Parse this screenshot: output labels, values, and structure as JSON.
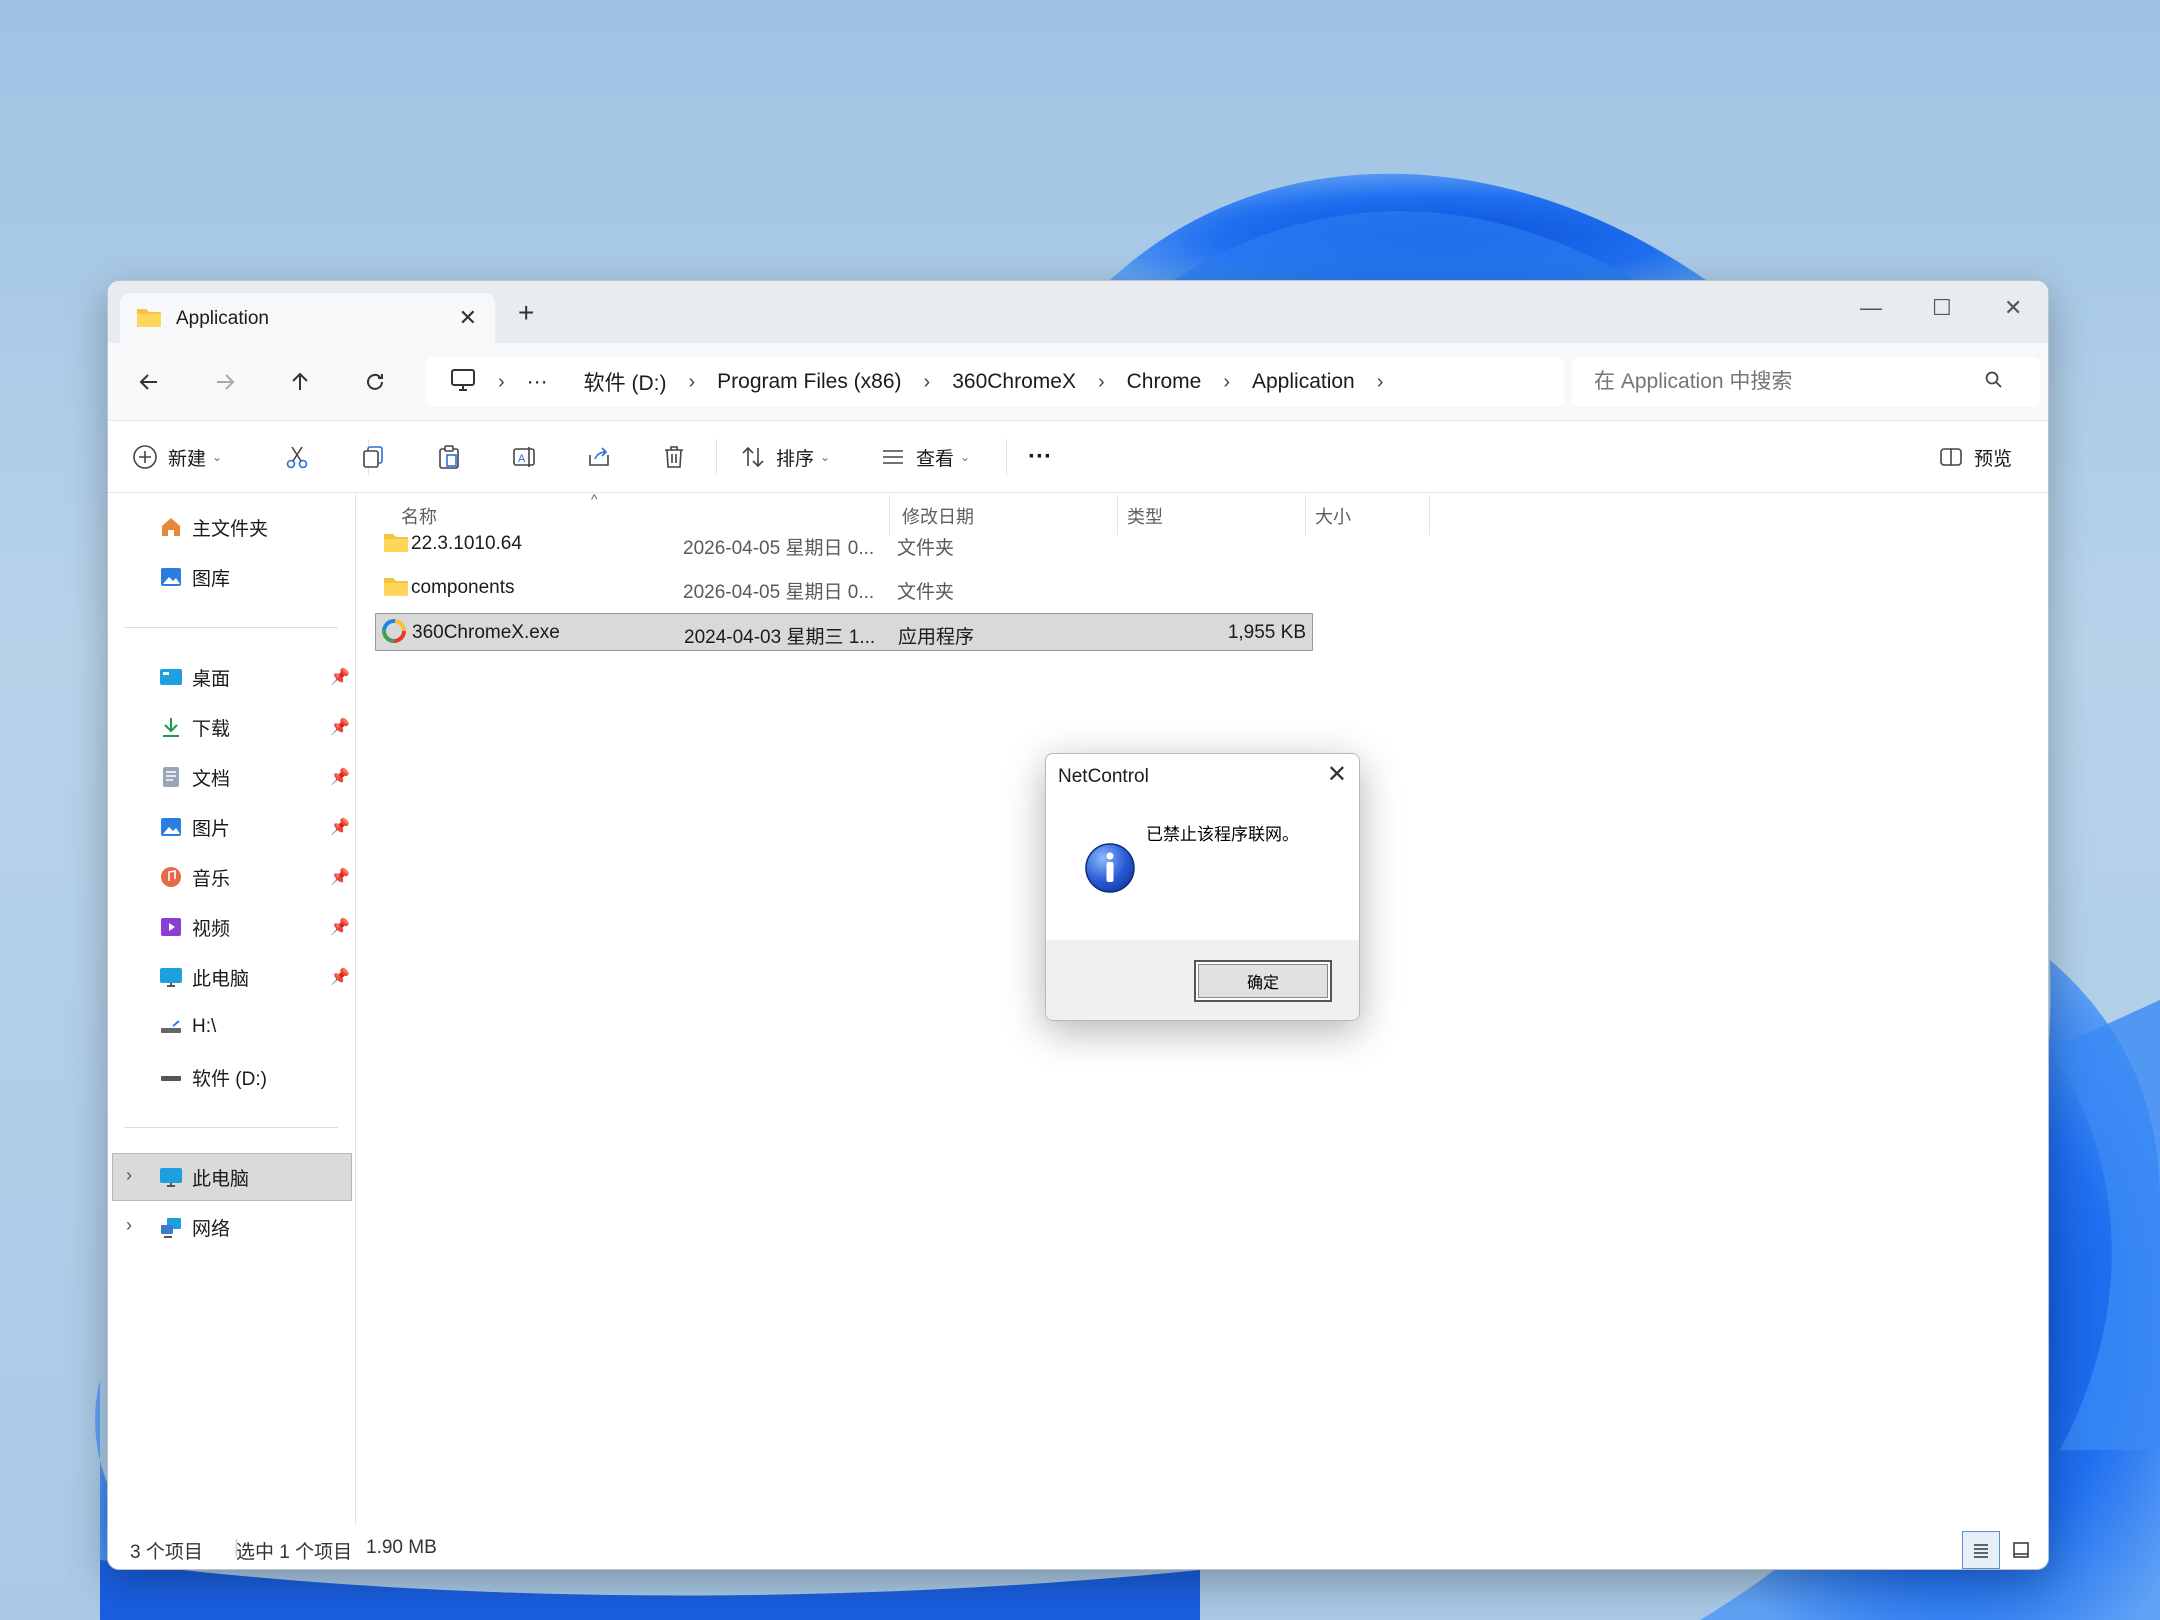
{
  "window": {
    "tab_title": "Application",
    "tab_close": "✕",
    "new_tab": "+",
    "minimize": "—",
    "maximize": "☐",
    "close": "✕"
  },
  "breadcrumb": {
    "more": "···",
    "items": [
      "软件 (D:)",
      "Program Files (x86)",
      "360ChromeX",
      "Chrome",
      "Application"
    ]
  },
  "search": {
    "placeholder": "在 Application 中搜索"
  },
  "toolbar": {
    "new_label": "新建",
    "sort_label": "排序",
    "view_label": "查看",
    "more_label": "···",
    "preview_label": "预览"
  },
  "sidebar": {
    "top": [
      {
        "label": "主文件夹",
        "icon": "home-icon"
      },
      {
        "label": "图库",
        "icon": "gallery-icon"
      }
    ],
    "quick": [
      {
        "label": "桌面",
        "icon": "desktop-icon"
      },
      {
        "label": "下载",
        "icon": "download-icon"
      },
      {
        "label": "文档",
        "icon": "document-icon"
      },
      {
        "label": "图片",
        "icon": "pictures-icon"
      },
      {
        "label": "音乐",
        "icon": "music-icon"
      },
      {
        "label": "视频",
        "icon": "video-icon"
      },
      {
        "label": "此电脑",
        "icon": "computer-icon"
      },
      {
        "label": "H:\\",
        "icon": "drive-icon"
      },
      {
        "label": "软件 (D:)",
        "icon": "drive-icon"
      }
    ],
    "tree": [
      {
        "label": "此电脑",
        "icon": "computer-icon"
      },
      {
        "label": "网络",
        "icon": "network-icon"
      }
    ]
  },
  "columns": {
    "name": "名称",
    "modified": "修改日期",
    "type": "类型",
    "size": "大小"
  },
  "files": [
    {
      "name": "22.3.1010.64",
      "modified": "2026-04-05 星期日 0...",
      "type": "文件夹",
      "size": "",
      "icon": "folder-icon"
    },
    {
      "name": "components",
      "modified": "2026-04-05 星期日 0...",
      "type": "文件夹",
      "size": "",
      "icon": "folder-icon"
    },
    {
      "name": "360ChromeX.exe",
      "modified": "2024-04-03 星期三 1...",
      "type": "应用程序",
      "size": "1,955 KB",
      "icon": "app-icon"
    }
  ],
  "status": {
    "count": "3 个项目",
    "selected": "选中 1 个项目",
    "size": "1.90 MB"
  },
  "dialog": {
    "title": "NetControl",
    "close": "✕",
    "message": "已禁止该程序联网。",
    "ok_label": "确定"
  }
}
